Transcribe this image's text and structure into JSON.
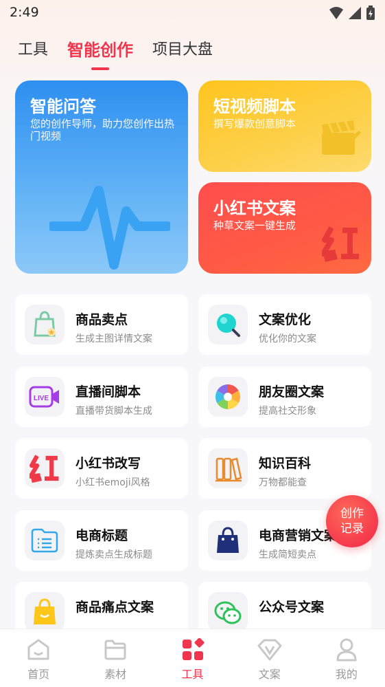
{
  "status_bar": {
    "time": "2:49"
  },
  "tabs": [
    {
      "label": "工具"
    },
    {
      "label": "智能创作"
    },
    {
      "label": "项目大盘"
    }
  ],
  "feature_cards": {
    "qa": {
      "title": "智能问答",
      "subtitle": "您的创作导师，助力您创作出热门视频",
      "icon": "waveform-icon"
    },
    "video": {
      "title": "短视频脚本",
      "subtitle": "撰写爆款创意脚本",
      "icon": "clapperboard-icon"
    },
    "xhs": {
      "title": "小红书文案",
      "subtitle": "种草文案一键生成",
      "icon": "hong-character-icon"
    }
  },
  "tools": [
    {
      "name": "商品卖点",
      "desc": "生成主图详情文案",
      "icon": "shopping-bag-star-icon"
    },
    {
      "name": "文案优化",
      "desc": "优化你的文案",
      "icon": "magnifier-icon"
    },
    {
      "name": "直播间脚本",
      "desc": "直播带货脚本生成",
      "icon": "live-camera-icon"
    },
    {
      "name": "朋友圈文案",
      "desc": "提高社交形象",
      "icon": "aperture-icon"
    },
    {
      "name": "小红书改写",
      "desc": "小红书emoji风格",
      "icon": "hong-character-icon"
    },
    {
      "name": "知识百科",
      "desc": "万物都能查",
      "icon": "books-icon"
    },
    {
      "name": "电商标题",
      "desc": "提炼卖点生成标题",
      "icon": "folder-list-icon"
    },
    {
      "name": "电商营销文案",
      "desc": "生成简短卖点",
      "icon": "shopping-bag-icon"
    },
    {
      "name": "商品痛点文案",
      "desc": "",
      "icon": "yellow-bag-icon"
    },
    {
      "name": "公众号文案",
      "desc": "",
      "icon": "wechat-icon"
    }
  ],
  "fab": {
    "line1": "创作",
    "line2": "记录"
  },
  "bottom_nav": [
    {
      "label": "首页",
      "icon": "home-icon"
    },
    {
      "label": "素材",
      "icon": "folder-icon"
    },
    {
      "label": "工具",
      "icon": "tools-grid-icon"
    },
    {
      "label": "文案",
      "icon": "copy-v-icon"
    },
    {
      "label": "我的",
      "icon": "person-icon"
    }
  ],
  "colors": {
    "accent": "#f0364f",
    "qa_card": "#3d9cf3",
    "video_card": "#fdc52a",
    "xhs_card": "#ff5148"
  }
}
